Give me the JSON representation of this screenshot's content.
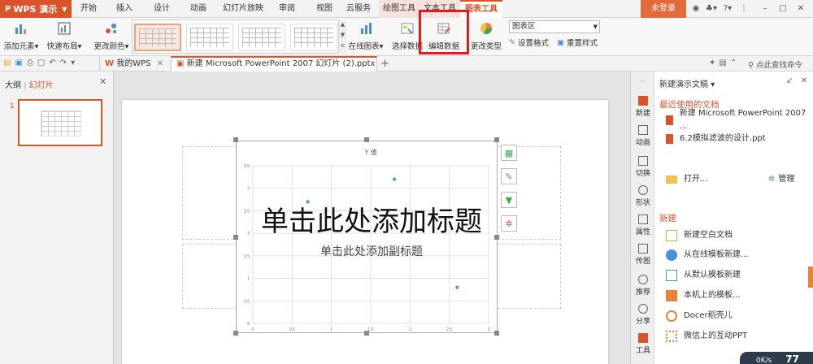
{
  "app": {
    "name": "WPS 演示",
    "login": "未登录"
  },
  "menu_tabs": [
    "开始",
    "插入",
    "设计",
    "动画",
    "幻灯片放映",
    "审阅",
    "视图",
    "云服务"
  ],
  "context_tabs": [
    "绘图工具",
    "文本工具",
    "图表工具"
  ],
  "ribbon": {
    "add_element": "添加元素",
    "quick_layout": "快速布局",
    "change_color": "更改颜色",
    "online_chart": "在线图表",
    "select_data": "选择数据",
    "edit_data": "编辑数据",
    "change_type": "更改类型",
    "chart_area": "图表区",
    "set_format": "设置格式",
    "reset_style": "重置样式"
  },
  "doc_tabs": {
    "my_wps": "我的WPS",
    "current": "新建 Microsoft PowerPoint 2007 幻灯片 (2).pptx *"
  },
  "search": {
    "label": "点此查找命令"
  },
  "left_panel": {
    "tab_outline": "大纲",
    "tab_slides": "幻灯片",
    "slide_number": "1"
  },
  "slide": {
    "title_placeholder": "单击此处添加标题",
    "subtitle_placeholder": "单击此处添加副标题"
  },
  "chart_data": {
    "type": "scatter",
    "title": "Y 值",
    "series": [
      {
        "values": [
          [
            0.7,
            2.7
          ],
          [
            1.8,
            3.2
          ],
          [
            2.6,
            0.8
          ]
        ]
      }
    ],
    "xlim": [
      0,
      3
    ],
    "ylim": [
      0,
      3.5
    ],
    "x_ticks": [
      "0",
      "0.5",
      "1",
      "1.5",
      "2",
      "2.5",
      "3"
    ],
    "y_ticks": [
      "0",
      "0.5",
      "1",
      "1.5",
      "2",
      "2.5",
      "3",
      "3.5"
    ],
    "grid": true,
    "color": "#5b9bd5"
  },
  "side_icons": [
    "新建",
    "动画",
    "切换",
    "形状",
    "属性",
    "传图",
    "推荐",
    "分享",
    "工具"
  ],
  "task_pane": {
    "header": "新建演示文稿",
    "recent_title": "最近使用的文档",
    "recent_files": [
      "新建 Microsoft PowerPoint 2007 ...",
      "6.2模拟滤波的设计.ppt"
    ],
    "open": "打开...",
    "manage": "管理",
    "new_title": "新建",
    "new_items": [
      "新建空白文档",
      "从在线模板新建...",
      "从默认模板新建",
      "本机上的模板...",
      "Docer稻壳儿",
      "微信上的互动PPT"
    ]
  },
  "status": {
    "speed": "0K/s",
    "value": "77"
  },
  "colors": {
    "brand": "#d9532b",
    "highlight": "#e31b1b",
    "accent": "#e46a3c"
  }
}
